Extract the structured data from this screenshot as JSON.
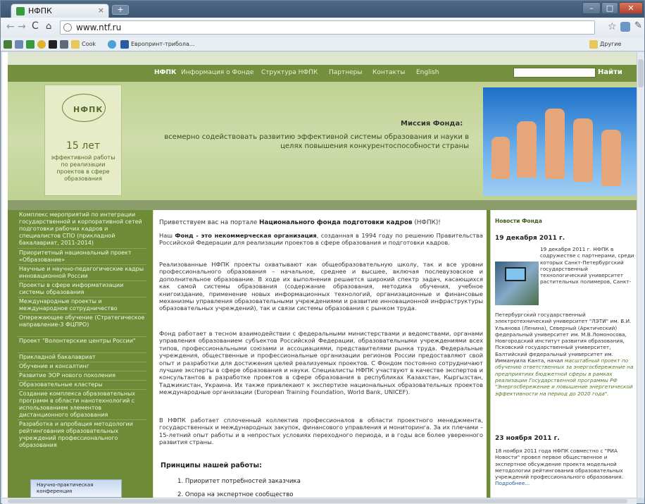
{
  "browser": {
    "tab_title": "НФПК",
    "url": "www.ntf.ru",
    "bookmarks": [
      "Cook",
      "Европринт-трибола...",
      "Другие закладки"
    ]
  },
  "site": {
    "menu": [
      "НФПК",
      "Информация о Фонде",
      "Структура НФПК",
      "Партнеры",
      "Контакты",
      "English"
    ],
    "search_button": "Найти",
    "logo_text": "НФПК",
    "years": "15 лет",
    "years_sub": "эффективной работы по реализации проектов в сфере образования",
    "mission_title": "Миссия Фонда:",
    "mission_text": "всемерно содействовать развитию эффективной системы образования и науки в целях повышения конкурентоспособности страны",
    "left_nav": [
      "Комплекс мероприятий по интеграции государственной и корпоративной сетей подготовки рабочих кадров и специалистов СПО (прикладной бакалавриат, 2011-2014)",
      "Приоритетный национальный проект «Образование»",
      "Научные и научно-педагогические кадры инновационной России",
      "Проекты в сфере информатизации системы образования",
      "Международные проекты и международное сотрудничество",
      "Опережающее обучение (Стратегическое направление-3 ФЦПРО)",
      "Проект \"Волонтерские центры России\"",
      "Прикладной бакалавриат",
      "Обучение и консалтинг",
      "Развитие ЭОР нового поколения",
      "Образовательные кластеры",
      "Создание комплекса образовательных программ в области нанотехнологий с использованием элементов дистанционного образования",
      "Разработка и апробация методологии рейтингования образовательных учреждений профессионального образования"
    ],
    "banner": "Научно-практическая конференция",
    "main": {
      "p1_a": "Приветствуем вас на портале ",
      "p1_b": "Национального фонда подготовки кадров",
      "p1_c": " (НФПК)!",
      "p2_a": "Наш ",
      "p2_b": "Фонд - это некоммерческая организация",
      "p2_c": ", созданная в 1994 году по решению Правительства Российской Федерации для реализации проектов в сфере образования и подготовки кадров.",
      "p3": "Реализованные НФПК проекты охватывают как общеобразовательную школу, так и все уровни профессионального образования – начальное, среднее и высшее, включая послевузовское и дополнительное образование. В ходе их выполнения решается широкий спектр задач, касающихся как самой системы образования (содержание образования, методика обучения, учебное книгоиздание, применение новых информационных технологий, организационные и финансовые механизмы управления образовательными учреждениями и развитие инновационной инфраструктуры образовательных учреждений), так и связи системы образования с рынком труда.",
      "p4": "Фонд работает в тесном взаимодействии с федеральными министерствами и ведомствами, органами управления образованием субъектов Российской Федерации, образовательными учреждениями всех типов, профессиональными союзами и ассоциациями, представителями рынка труда. Федеральные учреждения, общественные и профессиональные организации регионов России предоставляют свой опыт и разработки для достижения целей реализуемых проектов. С Фондом постоянно сотрудничают лучшие эксперты в сфере образования и науки. Специалисты НФПК участвуют в качестве экспертов и консультантов в разработке проектов в сфере образования в республиках Казахстан, Кыргызстан, Таджикистан, Украина. Их также привлекают к экспертизе национальных образовательных проектов международные организации (European Training Foundation, World Bank, UNICEF).",
      "p5": "В НФПК работает сплоченный коллектив профессионалов в области проектного менеджмента, государственных и международных закупок, финансового управления и мониторинга. За их плечами – 15-летний опыт работы и в непростых условиях переходного периода, и в годы все более уверенного развития страны.",
      "principles_title": "Принципы нашей работы:",
      "principles": [
        "1. Приоритет потребностей заказчика",
        "2. Опора на экспертное сообщество"
      ]
    },
    "news": {
      "title": "Новости Фонда",
      "date1": "19 декабря 2011 г.",
      "text1_top": "19 декабря 2011 г. НФПК в содружестве с партнерами, среди которых Санкт-Петербургский государственный технологический университет растительных полимеров, Санкт-",
      "text1_bottom_a": "Петербургский государственный электротехнический университет \"ЛЭТИ\" им. В.И. Ульянова (Ленина), Северный (Арктический) федеральный университет им. М.В.Ломоносова, Новгородский институт развития образования, Псковский государственный университет, Балтийский федеральный университет им. Иммануила Канта, начал ",
      "text1_bottom_b": "масштабный проект по обучению ответственных за энергосбережение на предприятиях бюджетной сферы в рамках реализации Государственной программы РФ \"Энергосбережение и повышение энергетической эффективности на период до 2020 года\".",
      "date2": "23 ноября 2011 г.",
      "text2": "18 ноября 2011 года НФПК совместно с \"РИА Новости\" провел первое общественное и экспертное обсуждение проекта модельной методологии рейтингования образовательных учреждений профессионального образования. ",
      "more": "Подробнее..."
    }
  }
}
